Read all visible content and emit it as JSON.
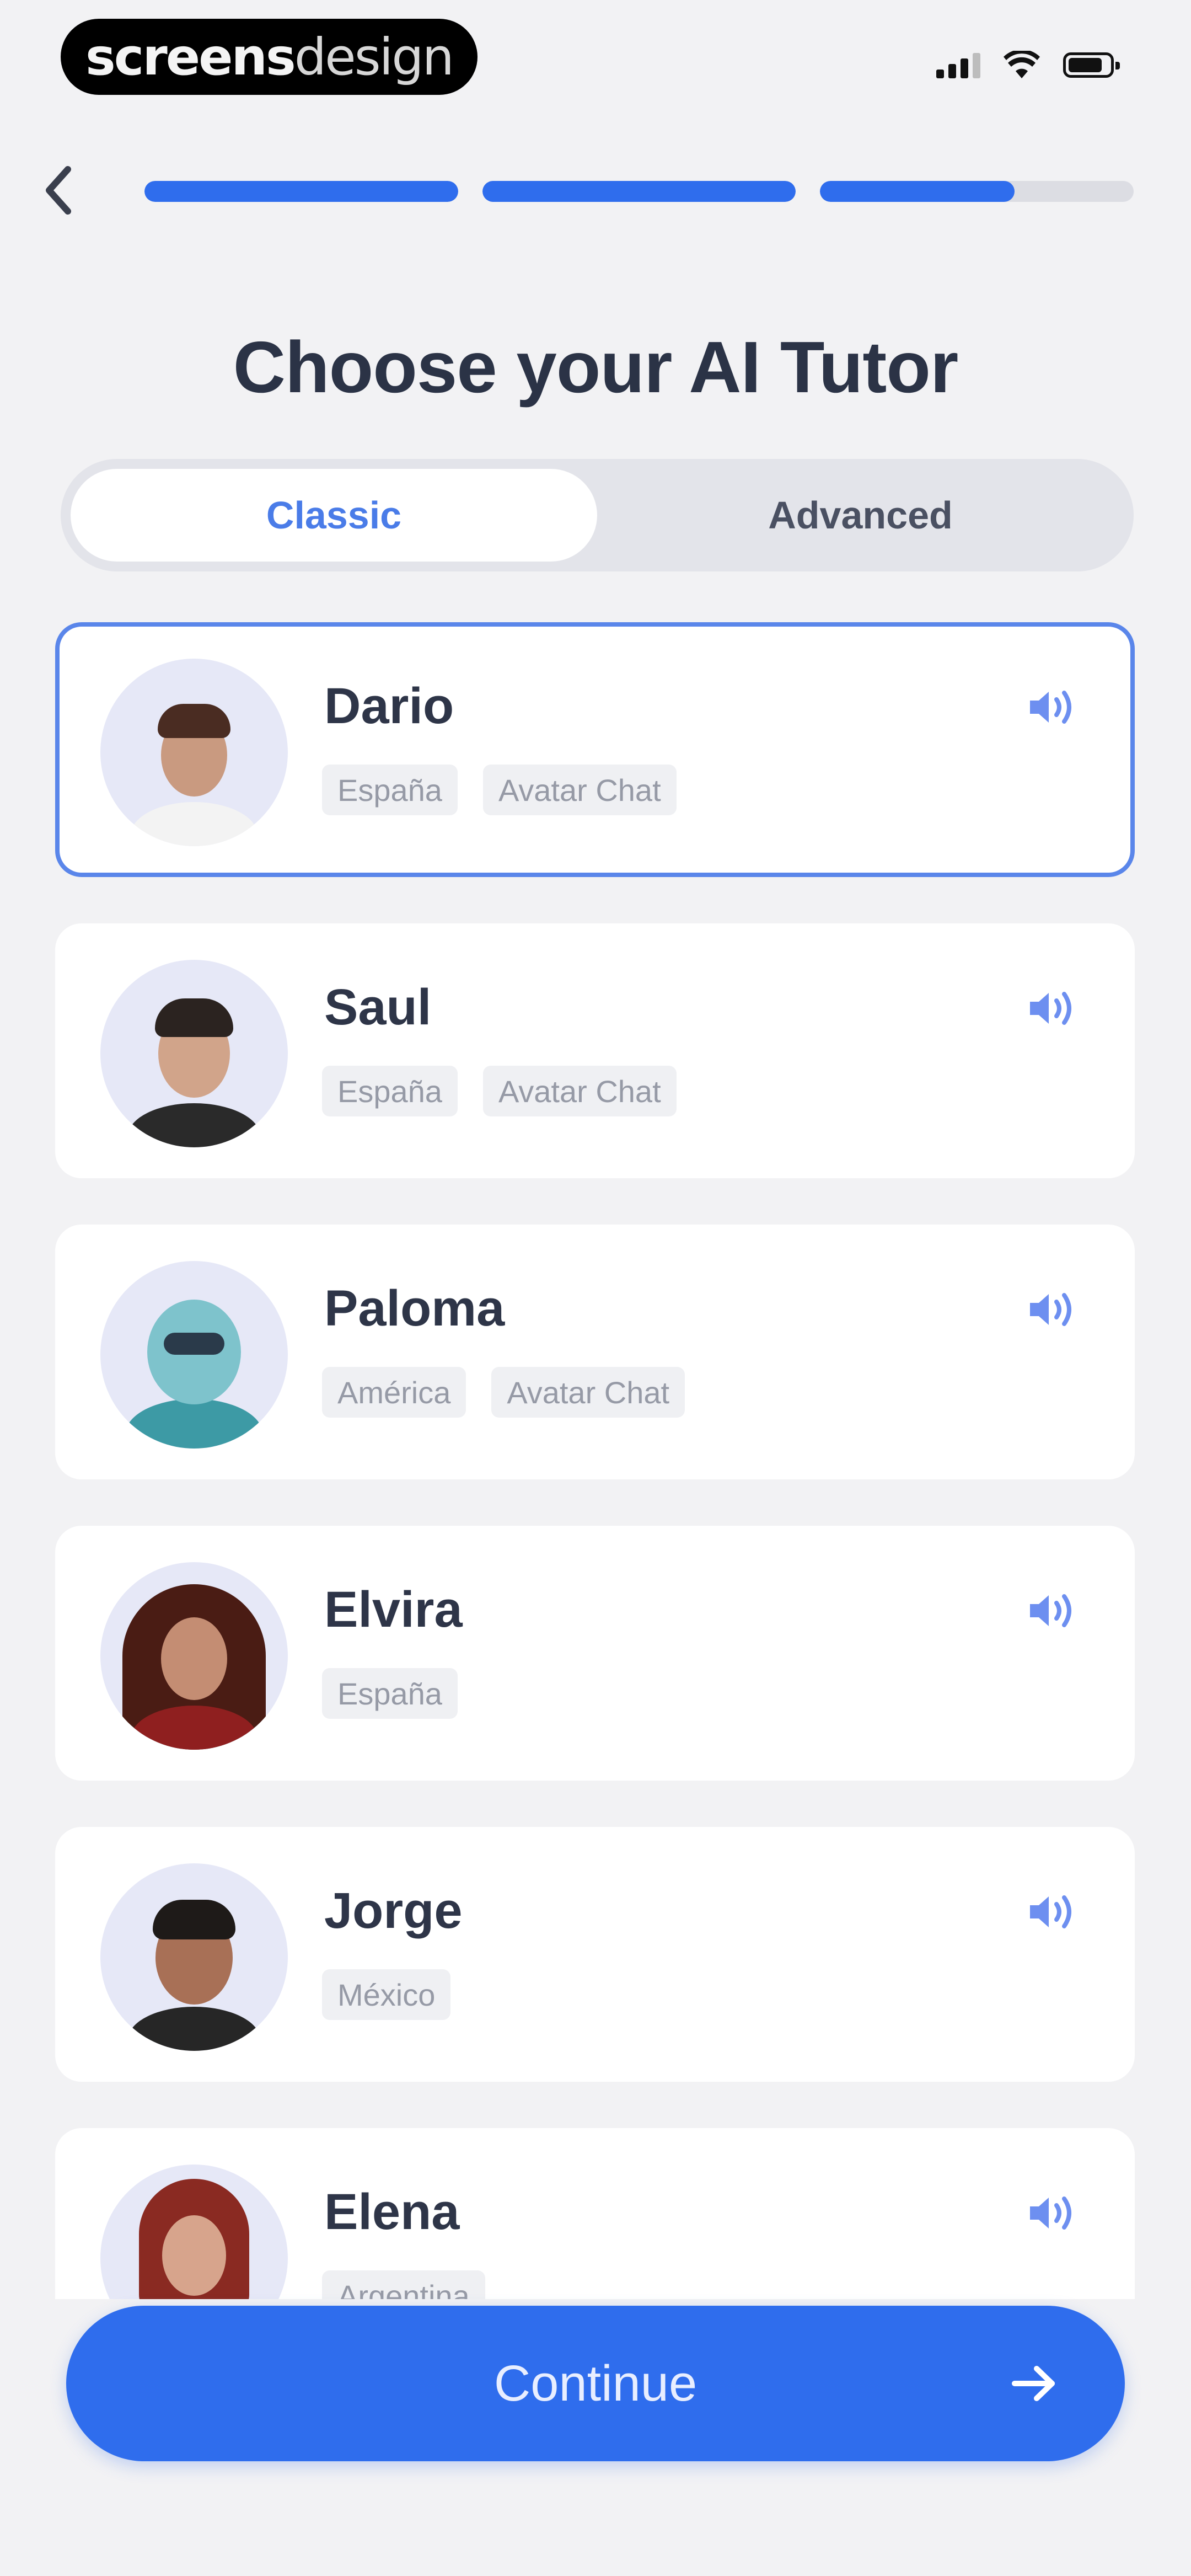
{
  "status_bar": {
    "brand_part1": "screens",
    "brand_part2": "design"
  },
  "progress": {
    "segments": [
      1.0,
      1.0,
      0.62
    ]
  },
  "title": "Choose your AI Tutor",
  "tabs": {
    "classic": "Classic",
    "advanced": "Advanced",
    "selected": "Classic"
  },
  "tutors": [
    {
      "name": "Dario",
      "tags": [
        "España",
        "Avatar Chat"
      ],
      "selected": true
    },
    {
      "name": "Saul",
      "tags": [
        "España",
        "Avatar Chat"
      ],
      "selected": false
    },
    {
      "name": "Paloma",
      "tags": [
        "América",
        "Avatar Chat"
      ],
      "selected": false
    },
    {
      "name": "Elvira",
      "tags": [
        "España"
      ],
      "selected": false
    },
    {
      "name": "Jorge",
      "tags": [
        "México"
      ],
      "selected": false
    },
    {
      "name": "Elena",
      "tags": [
        "Argentina"
      ],
      "selected": false
    }
  ],
  "continue_button": {
    "label": "Continue"
  },
  "colors": {
    "accent": "#2f6ded",
    "selected_border": "#5a86ea",
    "title": "#2b3346"
  }
}
